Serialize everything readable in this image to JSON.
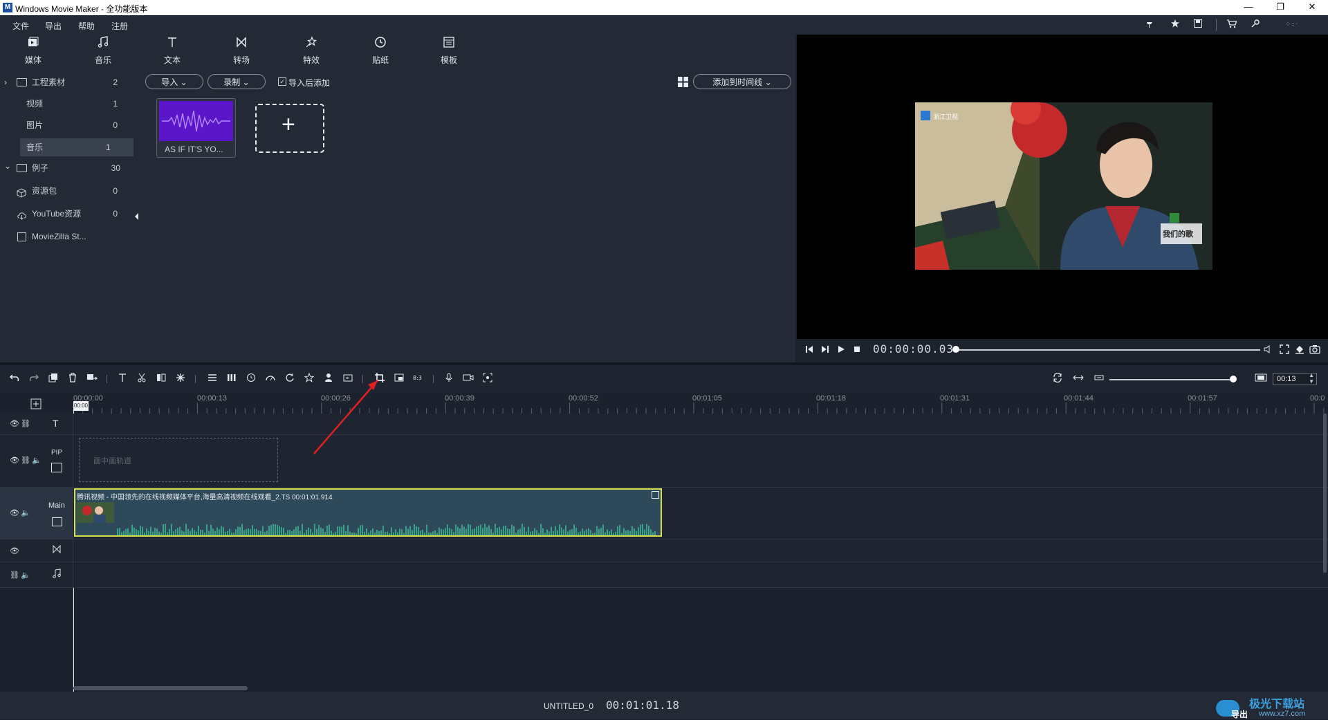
{
  "window": {
    "title": "Windows Movie Maker  - 全功能版本",
    "logo": "M",
    "controls": [
      "—",
      "❐",
      "✕"
    ]
  },
  "menu": [
    "文件",
    "导出",
    "帮助",
    "注册"
  ],
  "header_icons": [
    "pin-icon",
    "star-icon",
    "save-icon",
    "cart-icon",
    "key-icon",
    "share-icon"
  ],
  "categories": [
    {
      "label": "媒体",
      "icon": "media-icon"
    },
    {
      "label": "音乐",
      "icon": "music-icon"
    },
    {
      "label": "文本",
      "icon": "text-icon"
    },
    {
      "label": "转场",
      "icon": "transition-icon"
    },
    {
      "label": "特效",
      "icon": "effects-icon"
    },
    {
      "label": "贴纸",
      "icon": "sticker-icon"
    },
    {
      "label": "模板",
      "icon": "template-icon"
    }
  ],
  "tree": [
    {
      "label": "工程素材",
      "count": "2",
      "arrow": "›",
      "folder": true
    },
    {
      "label": "视频",
      "count": "1"
    },
    {
      "label": "图片",
      "count": "0"
    },
    {
      "label": "音乐",
      "count": "1",
      "selected": true
    },
    {
      "label": "例子",
      "count": "30",
      "arrow": "⌄",
      "folder": true
    },
    {
      "label": "资源包",
      "count": "0"
    },
    {
      "label": "YouTube资源",
      "count": "0"
    },
    {
      "label": "MovieZilla St...",
      "count": ""
    }
  ],
  "media_toolbar": {
    "import_label": "导入",
    "record_label": "录制",
    "import_add_label": "导入后添加",
    "import_add_checked": true,
    "add_to_timeline_label": "添加到时间线"
  },
  "media_items": [
    {
      "label": "AS IF IT'S YO..."
    }
  ],
  "preview": {
    "timecode": "00:00:00.03",
    "watermark": "浙江卫视",
    "badge": "我们的歌"
  },
  "timeline_toolbar": {
    "zoom_value": "00:13"
  },
  "ruler_labels": [
    "00:00:00",
    "00:00:13",
    "00:00:26",
    "00:00:39",
    "00:00:52",
    "00:01:05",
    "00:01:18",
    "00:01:31",
    "00:01:44",
    "00:01:57",
    "00:0"
  ],
  "playhead_label": "00:00",
  "tracks": {
    "pip_label": "PIP",
    "pip_placeholder": "画中画轨道",
    "main_label": "Main",
    "clip_title": "腾讯视频 - 中国领先的在线视频媒体平台,海量高清视频在线观看_2.TS   00:01:01.914"
  },
  "status": {
    "project": "UNTITLED_0",
    "duration": "00:01:01.18",
    "watermark_top": "极光下载站",
    "watermark_bottom": "www.xz7.com",
    "export_label": "导出"
  },
  "colors": {
    "accent_clip_border": "#d6e04a",
    "clip_bg": "#2e4a5a",
    "waveform": "#3aa08a",
    "media_thumb": "#5a16c8",
    "annotation_arrow": "#e02020"
  }
}
